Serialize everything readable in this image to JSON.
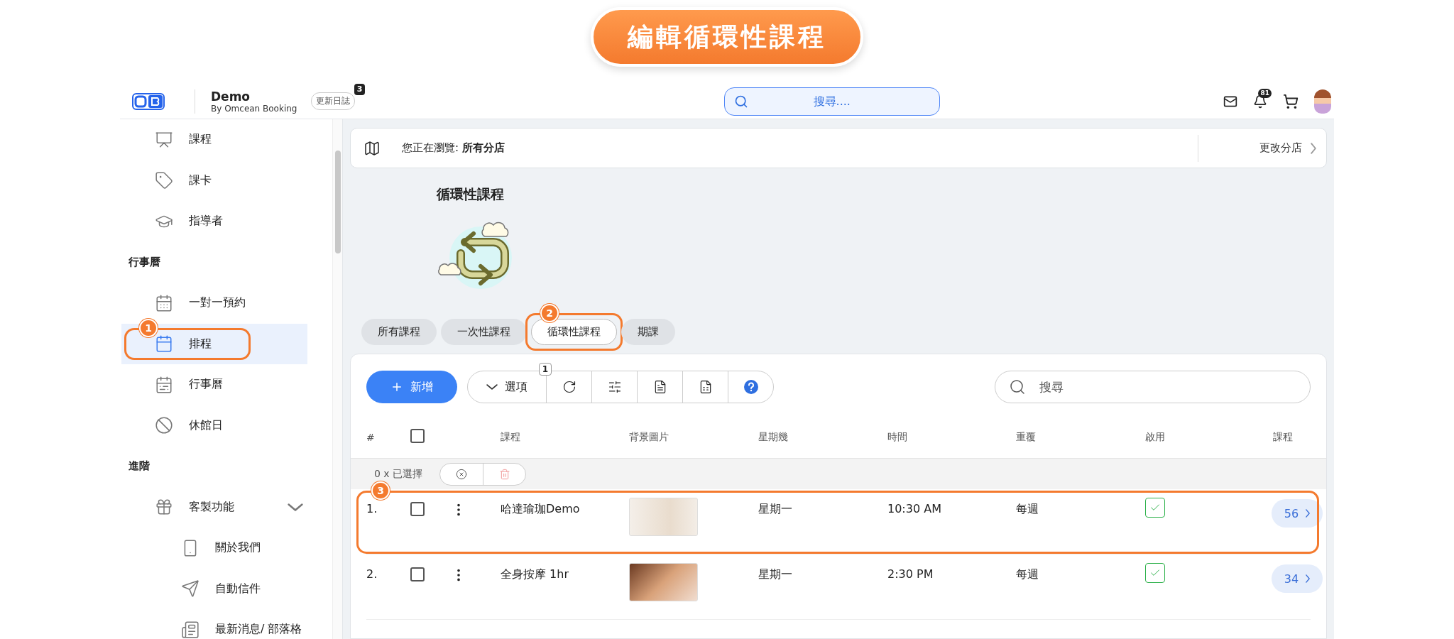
{
  "banner": {
    "title": "編輯循環性課程"
  },
  "header": {
    "brand": "Demo",
    "subtitle": "By Omcean Booking",
    "changelog": {
      "label": "更新日誌",
      "badge": "3"
    },
    "search": {
      "placeholder": "搜尋...."
    },
    "notifications": {
      "badge": "81"
    }
  },
  "sidebar": {
    "items": [
      {
        "kind": "item",
        "label": "課程",
        "selected": false
      },
      {
        "kind": "item",
        "label": "課卡",
        "selected": false
      },
      {
        "kind": "item",
        "label": "指導者",
        "selected": false
      },
      {
        "kind": "heading",
        "label": "行事曆"
      },
      {
        "kind": "item",
        "label": "一對一預約",
        "selected": false
      },
      {
        "kind": "item",
        "label": "排程",
        "selected": true,
        "callout": "1"
      },
      {
        "kind": "item",
        "label": "行事曆",
        "selected": false
      },
      {
        "kind": "item",
        "label": "休館日",
        "selected": false
      },
      {
        "kind": "heading",
        "label": "進階"
      },
      {
        "kind": "item",
        "label": "客製功能",
        "selected": false,
        "expanded": true,
        "children": [
          {
            "label": "關於我們",
            "selected": false
          },
          {
            "label": "自動信件",
            "selected": false
          },
          {
            "label": "最新消息/ 部落格",
            "selected": false
          }
        ]
      }
    ]
  },
  "branch_bar": {
    "text": "您正在瀏覽: **所有分店**",
    "action": "更改分店"
  },
  "page_title": "循環性課程",
  "tabs": [
    {
      "label": "所有課程",
      "selected": false
    },
    {
      "label": "一次性課程",
      "selected": false
    },
    {
      "label": "循環性課程",
      "selected": true,
      "callout": "2"
    },
    {
      "label": "期課",
      "selected": false
    }
  ],
  "toolbar": {
    "add": "新增",
    "options": {
      "label": "選項",
      "badge": "1"
    },
    "search": {
      "placeholder": "搜尋"
    }
  },
  "table": {
    "columns": [
      "#",
      "課程",
      "背景圖片",
      "星期幾",
      "時間",
      "重覆",
      "啟用",
      "課程"
    ],
    "all_checked": false,
    "selection": {
      "text": "0 x 已選擇"
    },
    "rows": [
      {
        "index": "1.",
        "checked": false,
        "name": "哈達瑜珈Demo",
        "day": "星期一",
        "time": "10:30 AM",
        "repeat": "每週",
        "enabled": true,
        "count": "56",
        "callout": "3"
      },
      {
        "index": "2.",
        "checked": false,
        "name": "全身按摩 1hr",
        "day": "星期一",
        "time": "2:30 PM",
        "repeat": "每週",
        "enabled": true,
        "count": "34"
      }
    ]
  }
}
